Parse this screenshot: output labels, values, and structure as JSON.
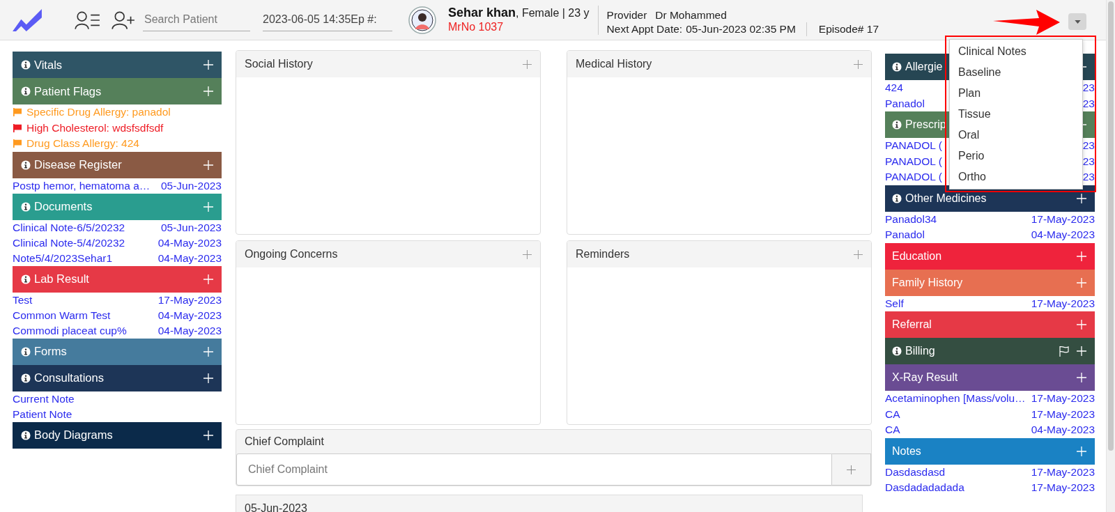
{
  "header": {
    "search": {
      "placeholder": "Search Patient"
    },
    "date_field": {
      "value": "2023-06-05 14:35Ep #:"
    },
    "patient": {
      "name": "Sehar khan",
      "details": ", Female | 23 y",
      "mrno": "MrNo 1037"
    },
    "provider": {
      "label": "Provider",
      "name": "Dr Mohammed",
      "appt_label": "Next Appt Date:",
      "appt_value": "05-Jun-2023 02:35 PM"
    },
    "episode": "Episode# 17"
  },
  "dropdown": {
    "open": true,
    "items": [
      "Clinical Notes",
      "Baseline",
      "Plan",
      "Tissue",
      "Oral",
      "Perio",
      "Ortho"
    ]
  },
  "left_column": [
    {
      "title": "Vitals",
      "color": "#2f5566",
      "info": true
    },
    {
      "title": "Patient Flags",
      "color": "#55805a",
      "info": true,
      "flags": [
        {
          "text": "Specific Drug Allergy: panadol",
          "color": "#ff9a1f"
        },
        {
          "text": "High Cholesterol: wdsfsdfsdf",
          "color": "#ee1c25"
        },
        {
          "text": "Drug Class Allergy: 424",
          "color": "#ff9a1f"
        }
      ]
    },
    {
      "title": "Disease Register",
      "color": "#8a5a44",
      "info": true,
      "rows": [
        {
          "label": "Postp hemor, hematoma a…",
          "date": "05-Jun-2023"
        }
      ]
    },
    {
      "title": "Documents",
      "color": "#2a9d8f",
      "info": true,
      "rows": [
        {
          "label": "Clinical Note-6/5/20232",
          "date": "05-Jun-2023"
        },
        {
          "label": "Clinical Note-5/4/20232",
          "date": "04-May-2023"
        },
        {
          "label": "Note5/4/2023Sehar1",
          "date": "04-May-2023"
        }
      ]
    },
    {
      "title": "Lab Result",
      "color": "#e63946",
      "info": true,
      "rows": [
        {
          "label": "Test",
          "date": "17-May-2023"
        },
        {
          "label": "Common Warm Test",
          "date": "04-May-2023"
        },
        {
          "label": "Commodi placeat cup%",
          "date": "04-May-2023"
        }
      ]
    },
    {
      "title": "Forms",
      "color": "#457b9d",
      "info": true
    },
    {
      "title": "Consultations",
      "color": "#1d3557",
      "info": true,
      "rows": [
        {
          "label": "Current Note"
        },
        {
          "label": "Patient Note"
        }
      ]
    },
    {
      "title": "Body Diagrams",
      "color": "#0b2a4a",
      "info": true
    }
  ],
  "panels": [
    {
      "title": "Social History"
    },
    {
      "title": "Medical History"
    },
    {
      "title": "Ongoing Concerns"
    },
    {
      "title": "Reminders"
    }
  ],
  "chief_complaint": {
    "title": "Chief Complaint",
    "placeholder": "Chief Complaint"
  },
  "date_panel": {
    "title": "05-Jun-2023"
  },
  "right_column": [
    {
      "title": "Allergie",
      "color": "#264653",
      "info": true,
      "rows": [
        {
          "label": "424",
          "date": "23"
        },
        {
          "label": "Panadol",
          "date": "23"
        }
      ]
    },
    {
      "title": "Prescrip",
      "color": "#55805a",
      "info": true,
      "rows": [
        {
          "label": "PANADOL (",
          "date": "23"
        },
        {
          "label": "PANADOL (",
          "date": "23"
        },
        {
          "label": "PANADOL (",
          "date": "23"
        }
      ]
    },
    {
      "title": "Other Medicines",
      "color": "#1d3557",
      "info": true,
      "rows": [
        {
          "label": "Panadol34",
          "date": "17-May-2023"
        },
        {
          "label": "Panadol",
          "date": "04-May-2023"
        }
      ]
    },
    {
      "title": "Education",
      "color": "#ef233c",
      "info": false
    },
    {
      "title": "Family History",
      "color": "#e76f51",
      "info": false,
      "rows": [
        {
          "label": "Self",
          "date": "17-May-2023"
        }
      ]
    },
    {
      "title": "Referral",
      "color": "#e63946",
      "info": false
    },
    {
      "title": "Billing",
      "color": "#344e41",
      "info": true,
      "flag_button": true
    },
    {
      "title": "X-Ray Result",
      "color": "#6a4c93",
      "info": false,
      "rows": [
        {
          "label": "Acetaminophen [Mass/volu…",
          "date": "17-May-2023"
        },
        {
          "label": "CA",
          "date": "17-May-2023"
        },
        {
          "label": "CA",
          "date": "04-May-2023"
        }
      ]
    },
    {
      "title": "Notes",
      "color": "#1a82c4",
      "info": false,
      "rows": [
        {
          "label": "Dasdasdasd",
          "date": "17-May-2023"
        },
        {
          "label": "Dasdadadadada",
          "date": "17-May-2023"
        }
      ]
    }
  ]
}
